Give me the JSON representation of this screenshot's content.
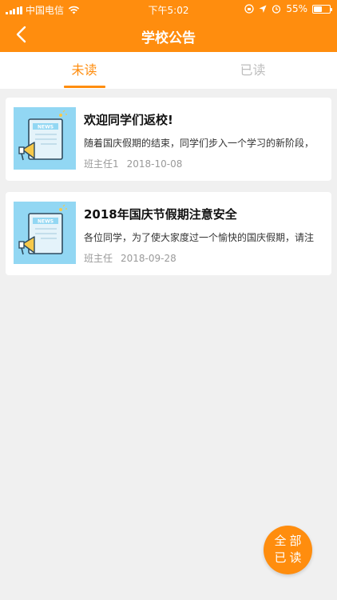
{
  "status_bar": {
    "carrier": "中国电信",
    "time": "下午5:02",
    "battery": "55%",
    "battery_level": 0.55
  },
  "nav": {
    "title": "学校公告",
    "back_icon": "chevron-left-icon"
  },
  "tabs": [
    {
      "label": "未读",
      "active": true
    },
    {
      "label": "已读",
      "active": false
    }
  ],
  "notices": [
    {
      "title": "欢迎同学们返校!",
      "excerpt": "随着国庆假期的结束，同学们步入一个学习的新阶段，",
      "author": "班主任1",
      "date": "2018-10-08",
      "thumb_label": "NEWS"
    },
    {
      "title": "2018年国庆节假期注意安全",
      "excerpt": "各位同学，为了使大家度过一个愉快的国庆假期，请注",
      "author": "班主任",
      "date": "2018-09-28",
      "thumb_label": "NEWS"
    }
  ],
  "fab": {
    "line1": "全部",
    "line2": "已读"
  },
  "colors": {
    "accent": "#ff8d0e",
    "thumb_bg": "#92d7f3",
    "inactive_tab": "#bdbdbd"
  }
}
